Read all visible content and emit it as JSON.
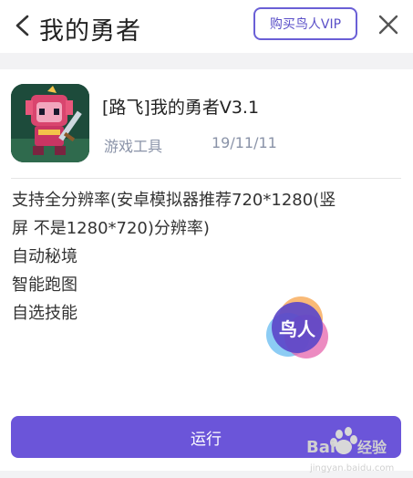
{
  "header": {
    "title": "我的勇者",
    "vip_label": "购买鸟人VIP"
  },
  "app": {
    "title": "[路飞]我的勇者V3.1",
    "category": "游戏工具",
    "date": "19/11/11",
    "description_lines": [
      "支持全分辨率(安卓模拟器推荐720*1280(竖",
      "屏 不是1280*720)分辨率)",
      "自动秘境",
      "智能跑图",
      "自选技能"
    ]
  },
  "badge": {
    "label": "鸟人"
  },
  "run_label": "运行",
  "watermark": {
    "brand": "Bai",
    "brand_cn": "经验",
    "domain": "jingyan.baidu.com"
  },
  "colors": {
    "accent": "#6b55d9",
    "meta_text": "#8a93a8"
  }
}
